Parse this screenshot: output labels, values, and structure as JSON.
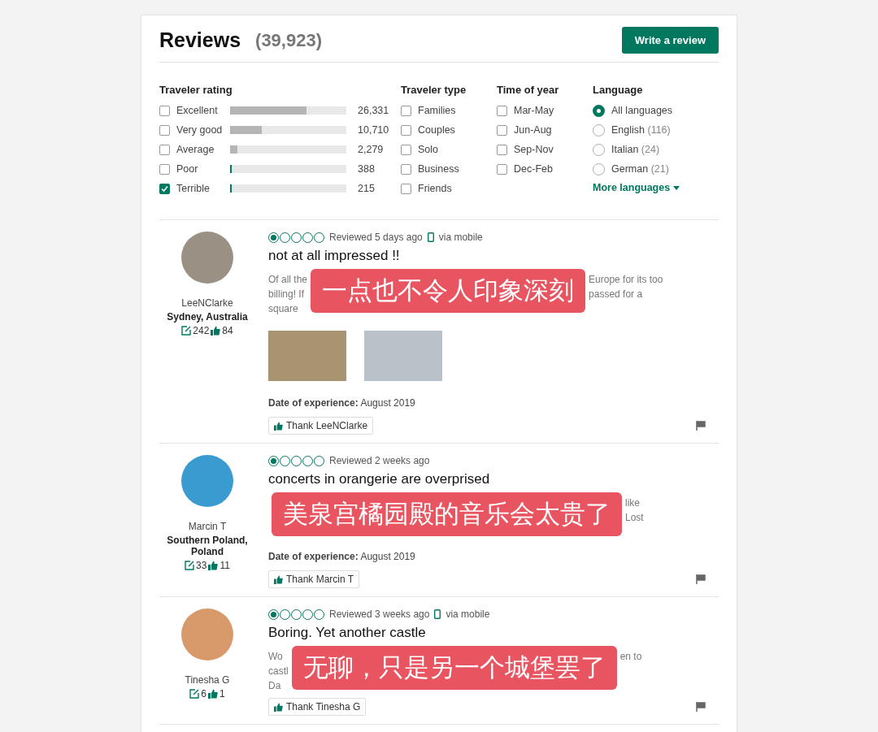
{
  "header": {
    "title": "Reviews",
    "count": "(39,923)",
    "button": "Write a review"
  },
  "filters": {
    "rating": {
      "title": "Traveler rating",
      "items": [
        {
          "label": "Excellent",
          "count": "26,331",
          "level": 0.66,
          "checked": false
        },
        {
          "label": "Very good",
          "count": "10,710",
          "level": 0.27,
          "checked": false
        },
        {
          "label": "Average",
          "count": "2,279",
          "level": 0.06,
          "checked": false
        },
        {
          "label": "Poor",
          "count": "388",
          "level": 0.01,
          "checked": false
        },
        {
          "label": "Terrible",
          "count": "215",
          "level": 0.01,
          "checked": true
        }
      ]
    },
    "type": {
      "title": "Traveler type",
      "items": [
        {
          "label": "Families",
          "checked": false
        },
        {
          "label": "Couples",
          "checked": false
        },
        {
          "label": "Solo",
          "checked": false
        },
        {
          "label": "Business",
          "checked": false
        },
        {
          "label": "Friends",
          "checked": false
        }
      ]
    },
    "time": {
      "title": "Time of year",
      "items": [
        {
          "label": "Mar-May",
          "checked": false
        },
        {
          "label": "Jun-Aug",
          "checked": false
        },
        {
          "label": "Sep-Nov",
          "checked": false
        },
        {
          "label": "Dec-Feb",
          "checked": false
        }
      ]
    },
    "language": {
      "title": "Language",
      "items": [
        {
          "label": "All languages",
          "selected": true
        },
        {
          "label": "English",
          "count": "(116)",
          "selected": false
        },
        {
          "label": "Italian",
          "count": "(24)",
          "selected": false
        },
        {
          "label": "German",
          "count": "(21)",
          "selected": false
        }
      ],
      "more": "More languages"
    }
  },
  "reviews": [
    {
      "user": "LeeNClarke",
      "location": "Sydney, Australia",
      "contributions": "242",
      "helpful": "84",
      "stars": 1,
      "date": "Reviewed 5 days ago",
      "mobile": "via mobile",
      "title": "not at all impressed !!",
      "body_left": "Of all the\nbilling! If\nsquare",
      "body_right": "Europe for its too\npassed for a",
      "caption": "一点也不令人印象深刻",
      "photos": [
        {
          "kind": "palace"
        },
        {
          "kind": "square"
        }
      ],
      "experience_label": "Date of experience:",
      "experience": "August 2019",
      "thank": "Thank LeeNClarke"
    },
    {
      "user": "Marcin T",
      "location": "Southern Poland, Poland",
      "contributions": "33",
      "helpful": "11",
      "stars": 1,
      "date": "Reviewed 2 weeks ago",
      "title": "concerts in orangerie are overprised",
      "body_right": "like\nLost",
      "caption": "美泉宫橘园殿的音乐会太贵了",
      "experience_label": "Date of experience:",
      "experience": "August 2019",
      "thank": "Thank Marcin T"
    },
    {
      "user": "Tinesha G",
      "contributions": "6",
      "helpful": "1",
      "stars": 1,
      "date": "Reviewed 3 weeks ago",
      "mobile": "via mobile",
      "title": "Boring. Yet another castle",
      "body_left": "Wo\ncastl\nDa",
      "body_right": "en to",
      "caption": "无聊，只是另一个城堡罢了",
      "thank": "Thank Tinesha G"
    }
  ]
}
